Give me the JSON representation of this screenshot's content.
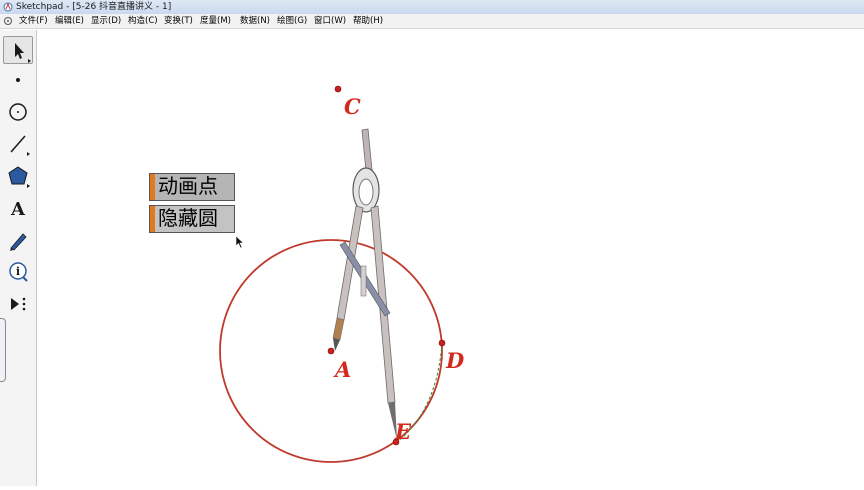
{
  "window": {
    "title": "Sketchpad  - [5-26 抖音直播讲义 - 1]"
  },
  "menu": [
    "文件(F)",
    "编辑(E)",
    "显示(D)",
    "构造(C)",
    "变换(T)",
    "度量(M)",
    "数据(N)",
    "绘图(G)",
    "窗口(W)",
    "帮助(H)"
  ],
  "tools": [
    "arrow-tool",
    "point-tool",
    "compass-tool",
    "straightedge-tool",
    "polygon-tool",
    "text-tool",
    "marker-tool",
    "information-tool",
    "custom-tool"
  ],
  "buttons": {
    "animate": "动画点",
    "hide": "隐藏圆"
  },
  "labels": {
    "A": "A",
    "C": "C",
    "D": "D",
    "E": "E"
  },
  "colors": {
    "circle": "#c0392b",
    "point": "#cc1f1f",
    "label": "#d42a1e",
    "arc": "#3a8a3a",
    "button_handle": "#e07a1a"
  }
}
